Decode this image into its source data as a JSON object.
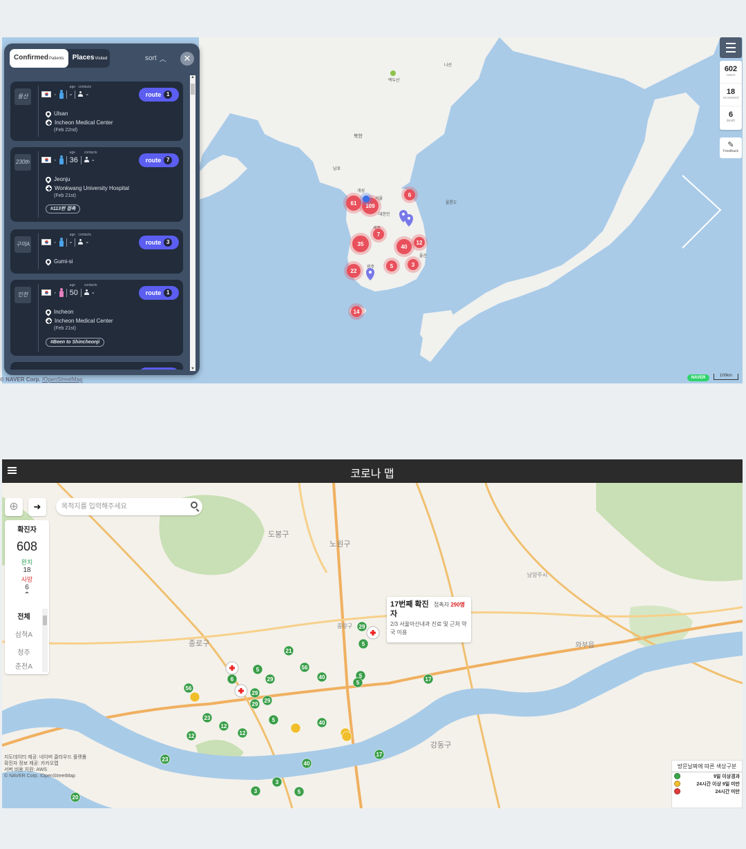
{
  "top": {
    "panel": {
      "tabs": [
        {
          "label": "Confirmed",
          "sub": "Patients",
          "active": true
        },
        {
          "label": "Places",
          "sub": "Visited",
          "active": false
        }
      ],
      "sort_label": "sort",
      "close_icon": "close-icon",
      "field_labels": {
        "age": "age",
        "contacts": "contacts"
      },
      "route_label": "route",
      "patients": [
        {
          "badge": "울산",
          "gender": "male",
          "age": "-",
          "contacts": "-",
          "route_count": "1",
          "location": "Ulsan",
          "hospital": "Incheon Medical Center",
          "date": "(Feb 22nd)",
          "tag": ""
        },
        {
          "badge": "230th",
          "gender": "male",
          "age": "36",
          "contacts": "-",
          "route_count": "7",
          "location": "Jeonju",
          "hospital": "Wonkwang University Hospital",
          "date": "(Feb 21st)",
          "tag": "#113번 접촉"
        },
        {
          "badge": "구미A",
          "gender": "male",
          "age": "-",
          "contacts": "-",
          "route_count": "3",
          "location": "Gumi-si",
          "hospital": "",
          "date": "",
          "tag": ""
        },
        {
          "badge": "인천",
          "gender": "female",
          "age": "50",
          "contacts": "-",
          "route_count": "1",
          "location": "Incheon",
          "hospital": "Incheon Medical Center",
          "date": "(Feb 21st)",
          "tag": "#Been to Shincheonji"
        }
      ]
    },
    "stats": [
      {
        "value": "602",
        "label": "cases"
      },
      {
        "value": "18",
        "label": "recovered"
      },
      {
        "value": "6",
        "label": "death"
      }
    ],
    "feedback_label": "Feedback",
    "attribution": "© NAVER Corp.",
    "attribution_link": "/OpenStreetMap",
    "naver_logo": "NAVER",
    "scale": "100km",
    "map_labels": [
      "백두산",
      "북한",
      "남포",
      "개성",
      "서울",
      "대한민",
      "세종",
      "광주",
      "울산",
      "나선",
      "울릉도"
    ],
    "clusters": [
      {
        "count": "61",
        "color": "#e8505b"
      },
      {
        "count": "109",
        "color": "#e8505b"
      },
      {
        "count": "6",
        "color": "#e8505b"
      },
      {
        "count": "7",
        "color": "#e8505b"
      },
      {
        "count": "35",
        "color": "#e8505b"
      },
      {
        "count": "40",
        "color": "#e8505b"
      },
      {
        "count": "12",
        "color": "#e8505b"
      },
      {
        "count": "22",
        "color": "#e8505b"
      },
      {
        "count": "5",
        "color": "#e8505b"
      },
      {
        "count": "3",
        "color": "#e8505b"
      },
      {
        "count": "14",
        "color": "#e8505b"
      }
    ]
  },
  "bottom": {
    "title": "코로나 맵",
    "search_placeholder": "목적지를 입력해주세요",
    "stats": {
      "confirmed_label": "확진자",
      "confirmed": "608",
      "recovered_label": "완치",
      "recovered": "18",
      "death_label": "사망",
      "death": "6"
    },
    "regions": [
      {
        "label": "전체",
        "active": true
      },
      {
        "label": "삼척A",
        "active": false
      },
      {
        "label": "청주",
        "active": false
      },
      {
        "label": "춘천A",
        "active": false
      }
    ],
    "popup": {
      "title": "17번째 확진자",
      "contacts_label": "접촉자",
      "contacts_value": "290명",
      "description": "2/3 서울아산내과 진료 및 근처 약국 이용"
    },
    "legend": {
      "title": "방문날짜에 따른 색상구분",
      "items": [
        {
          "label": "9일 이상경과",
          "color": "#3aa84a"
        },
        {
          "label": "24시간 이상 9일 미만",
          "color": "#f2c12e"
        },
        {
          "label": "24시간 미만",
          "color": "#e23b3b"
        }
      ]
    },
    "attribution_lines": [
      "지도데이터 제공: 네이버 클라우드 플랫폼",
      "확진자 정보 제공: 카카오맵",
      "서버 비용 지원: AWS",
      "© NAVER Corp. /OpenStreetMap"
    ],
    "map_labels": [
      "종로구",
      "도봉구",
      "노원구",
      "강동구",
      "중랑구",
      "와부읍",
      "남양주시"
    ],
    "markers": [
      {
        "n": "29",
        "c": "green"
      },
      {
        "n": "5",
        "c": "green"
      },
      {
        "n": "21",
        "c": "green"
      },
      {
        "n": "56",
        "c": "green"
      },
      {
        "n": "40",
        "c": "green"
      },
      {
        "n": "5",
        "c": "green"
      },
      {
        "n": "5",
        "c": "green"
      },
      {
        "n": "17",
        "c": "green"
      },
      {
        "n": "6",
        "c": "green"
      },
      {
        "n": "5",
        "c": "green"
      },
      {
        "n": "29",
        "c": "green"
      },
      {
        "n": "56",
        "c": "green"
      },
      {
        "n": "29",
        "c": "green"
      },
      {
        "n": "29",
        "c": "green"
      },
      {
        "n": "29",
        "c": "green"
      },
      {
        "n": "23",
        "c": "green"
      },
      {
        "n": "12",
        "c": "green"
      },
      {
        "n": "12",
        "c": "green"
      },
      {
        "n": "12",
        "c": "green"
      },
      {
        "n": "5",
        "c": "green"
      },
      {
        "n": "40",
        "c": "green"
      },
      {
        "n": "23",
        "c": "green"
      },
      {
        "n": "40",
        "c": "green"
      },
      {
        "n": "17",
        "c": "green"
      },
      {
        "n": "3",
        "c": "green"
      },
      {
        "n": "3",
        "c": "green"
      },
      {
        "n": "5",
        "c": "green"
      },
      {
        "n": "20",
        "c": "green"
      },
      {
        "n": "",
        "c": "yellow"
      },
      {
        "n": "",
        "c": "yellow"
      },
      {
        "n": "",
        "c": "yellow"
      },
      {
        "n": "",
        "c": "yellow"
      }
    ]
  }
}
